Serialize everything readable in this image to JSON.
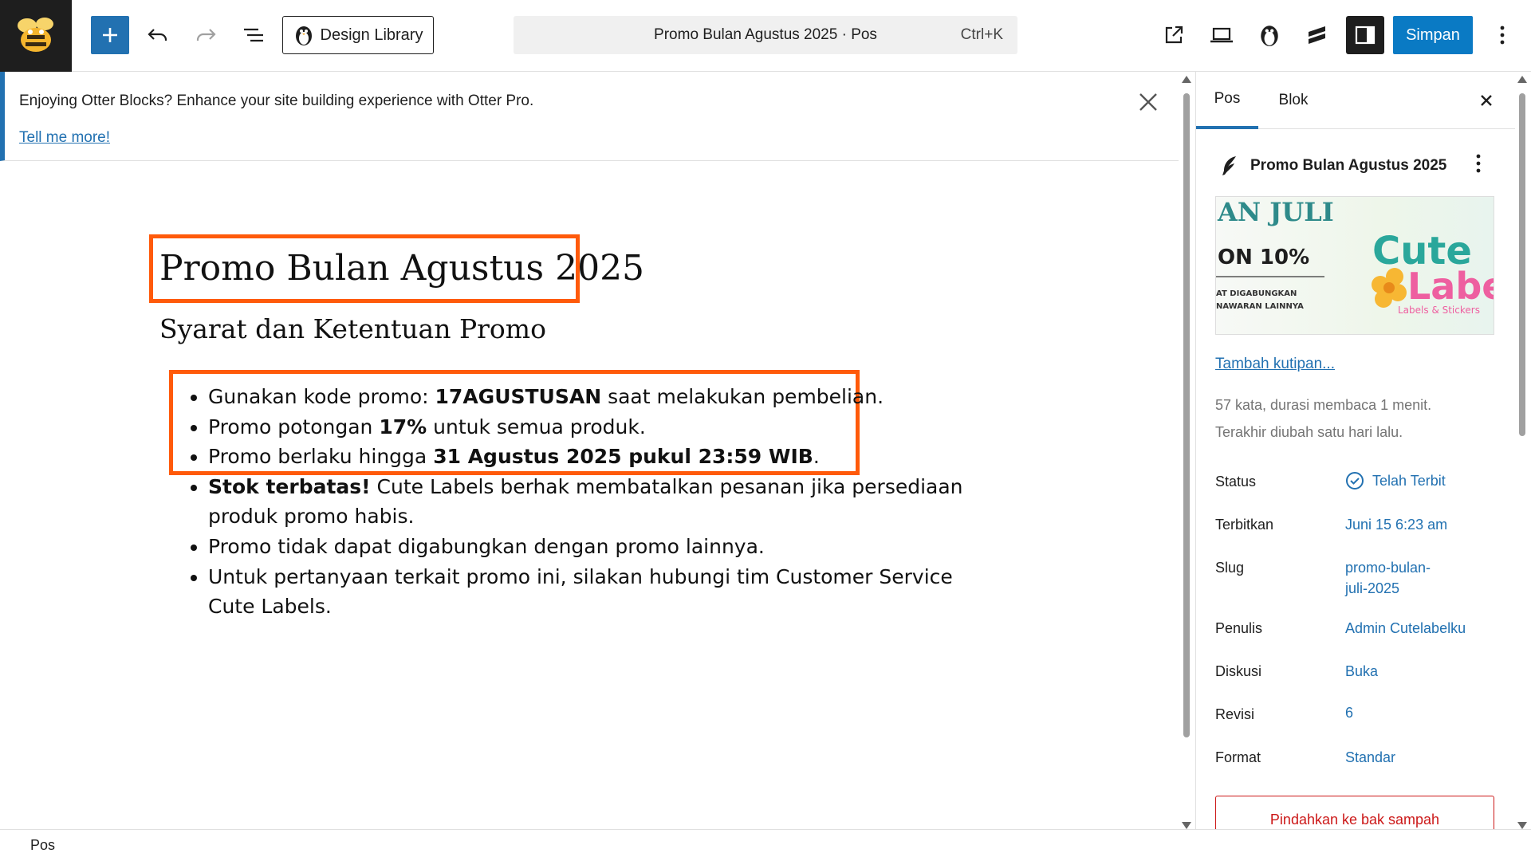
{
  "toolbar": {
    "design_library_label": "Design Library",
    "command_title": "Promo Bulan Agustus 2025 · Pos",
    "command_shortcut": "Ctrl+K",
    "save_label": "Simpan"
  },
  "notice": {
    "text": "Enjoying Otter Blocks? Enhance your site building experience with Otter Pro.",
    "link": "Tell me more!"
  },
  "content": {
    "title": "Promo Bulan Agustus 2025",
    "subheading": "Syarat dan Ketentuan Promo",
    "items": [
      {
        "pre": "Gunakan kode promo: ",
        "bold": "17AGUSTUSAN",
        "post": " saat melakukan pembelian."
      },
      {
        "pre": "Promo potongan ",
        "bold": "17%",
        "post": " untuk semua produk."
      },
      {
        "pre": "Promo berlaku hingga ",
        "bold": "31 Agustus 2025 pukul 23:59 WIB",
        "post": "."
      },
      {
        "pre": "",
        "bold": "Stok terbatas!",
        "post": " Cute Labels berhak membatalkan pesanan jika persediaan produk promo habis."
      },
      {
        "pre": "Promo tidak dapat digabungkan dengan promo lainnya.",
        "bold": "",
        "post": ""
      },
      {
        "pre": "Untuk pertanyaan terkait promo ini, silakan hubungi tim Customer Service Cute Labels.",
        "bold": "",
        "post": ""
      }
    ]
  },
  "sidebar": {
    "tab_post": "Pos",
    "tab_block": "Blok",
    "post_title": "Promo Bulan Agustus 2025",
    "image_text": {
      "line1": "AN JULI",
      "line2": "ON 10%",
      "line3": "AT DIGABUNGKAN",
      "line4": "NAWARAN LAINNYA",
      "brand1": "Cute",
      "brand2": "Labe",
      "brand_sub": "Labels & Stickers"
    },
    "add_excerpt": "Tambah kutipan...",
    "word_count": "57 kata, durasi membaca 1 menit.",
    "last_modified": "Terakhir diubah satu hari lalu.",
    "rows": {
      "status_label": "Status",
      "status_value": "Telah Terbit",
      "publish_label": "Terbitkan",
      "publish_value": "Juni 15 6:23 am",
      "slug_label": "Slug",
      "slug_value_1": "promo-bulan-",
      "slug_value_2": "juli-2025",
      "author_label": "Penulis",
      "author_value": "Admin Cutelabelku",
      "discussion_label": "Diskusi",
      "discussion_value": "Buka",
      "revisions_label": "Revisi",
      "revisions_value": "6",
      "format_label": "Format",
      "format_value": "Standar"
    },
    "trash_label": "Pindahkan ke bak sampah"
  },
  "footer": {
    "breadcrumb": "Pos"
  }
}
